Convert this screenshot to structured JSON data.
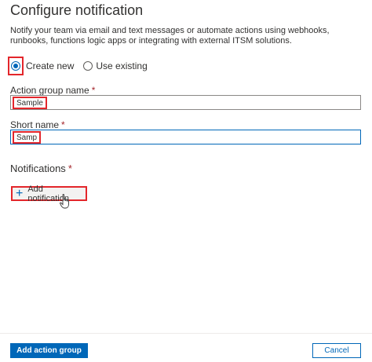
{
  "panel": {
    "title": "Configure notification",
    "description": "Notify your team via email and text messages or automate actions using webhooks, runbooks, functions logic apps or integrating with external ITSM solutions."
  },
  "radio": {
    "create_new": "Create new",
    "use_existing": "Use existing",
    "selected": "create_new"
  },
  "action_group_name": {
    "label": "Action group name",
    "required_mark": "*",
    "value": "Sample"
  },
  "short_name": {
    "label": "Short name",
    "required_mark": "*",
    "value": "Samp"
  },
  "notifications": {
    "title": "Notifications",
    "required_mark": "*",
    "add_label": "Add notification"
  },
  "footer": {
    "primary_label": "Add action group",
    "cancel_label": "Cancel"
  },
  "colors": {
    "accent": "#0067b8",
    "highlight": "#e3262b"
  }
}
